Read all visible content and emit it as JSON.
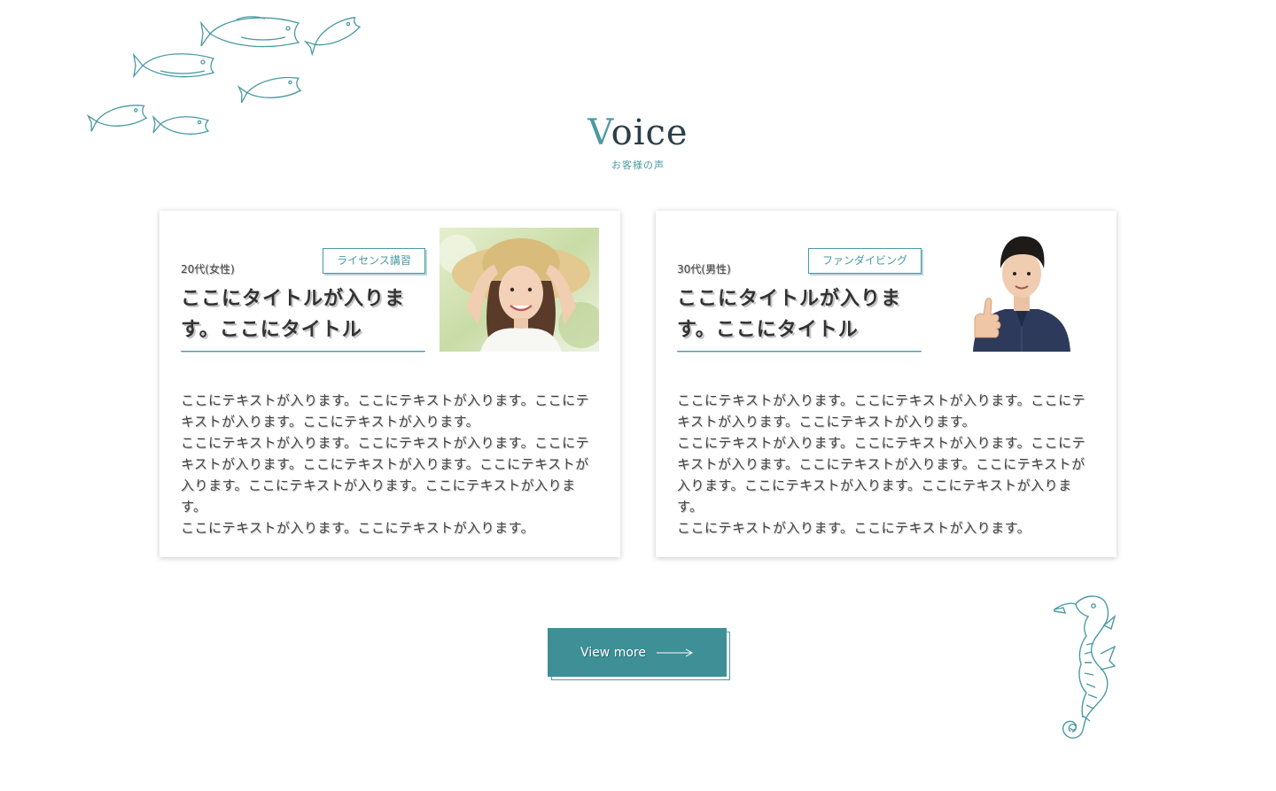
{
  "theme": {
    "accent": "#4a9aa3",
    "button_bg": "#3e8f96",
    "text": "#333333"
  },
  "decorations": {
    "top_left": "fish-school-illustration",
    "bottom_right": "seahorse-illustration"
  },
  "section": {
    "title_first": "V",
    "title_rest": "oice",
    "subtitle": "お客様の声"
  },
  "voices": [
    {
      "age": "20代(女性)",
      "tag": "ライセンス講習",
      "title": "ここにタイトルが入ります。ここにタイトル",
      "photo": "woman-in-straw-hat-photo",
      "paragraphs": [
        "ここにテキストが入ります。ここにテキストが入ります。ここにテキストが入ります。ここにテキストが入ります。",
        "ここにテキストが入ります。ここにテキストが入ります。ここにテキストが入ります。ここにテキストが入ります。ここにテキストが入ります。ここにテキストが入ります。ここにテキストが入ります。",
        "ここにテキストが入ります。ここにテキストが入ります。"
      ]
    },
    {
      "age": "30代(男性)",
      "tag": "ファンダイビング",
      "title": "ここにタイトルが入ります。ここにタイトル",
      "photo": "man-thumbs-up-photo",
      "paragraphs": [
        "ここにテキストが入ります。ここにテキストが入ります。ここにテキストが入ります。ここにテキストが入ります。",
        "ここにテキストが入ります。ここにテキストが入ります。ここにテキストが入ります。ここにテキストが入ります。ここにテキストが入ります。ここにテキストが入ります。ここにテキストが入ります。",
        "ここにテキストが入ります。ここにテキストが入ります。"
      ]
    }
  ],
  "button": {
    "label": "View more",
    "icon": "long-arrow-right-icon"
  }
}
